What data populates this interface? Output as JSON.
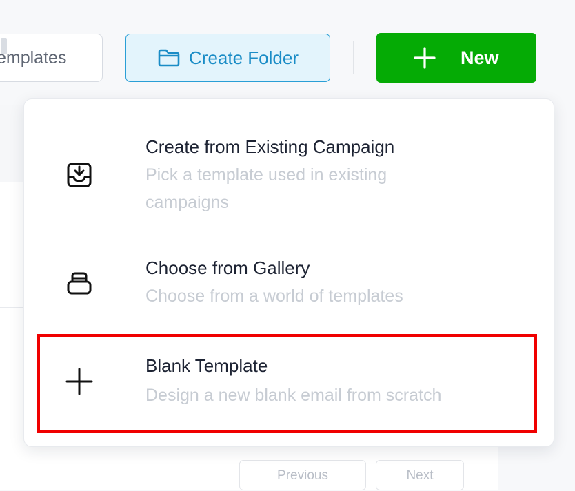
{
  "toolbar": {
    "search_placeholder": "emplates",
    "create_folder_label": "Create Folder",
    "new_label": "New"
  },
  "dropdown": {
    "items": [
      {
        "icon": "inbox-download-icon",
        "title": "Create from Existing Campaign",
        "description": "Pick a template used in existing campaigns"
      },
      {
        "icon": "gallery-stack-icon",
        "title": "Choose from Gallery",
        "description": "Choose from a world of templates"
      },
      {
        "icon": "plus-icon",
        "title": "Blank Template",
        "description": "Design a new blank email from scratch",
        "highlighted": true
      }
    ]
  },
  "pagination": {
    "previous_label": "Previous",
    "next_label": "Next"
  },
  "colors": {
    "accent_blue": "#1a8cc6",
    "primary_green": "#05ab05",
    "highlight_red": "#f00000"
  }
}
